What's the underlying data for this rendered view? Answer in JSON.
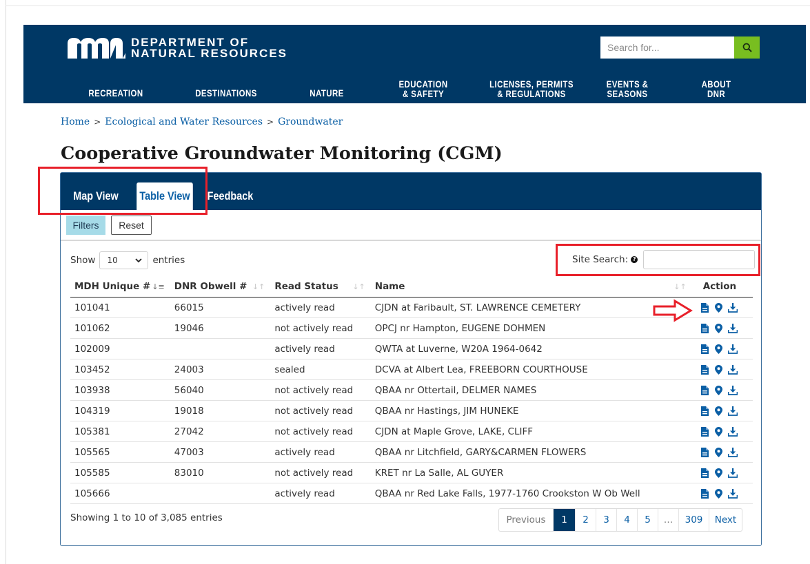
{
  "header": {
    "logo_text_line1": "DEPARTMENT OF",
    "logo_text_line2": "NATURAL RESOURCES",
    "search_placeholder": "Search for...",
    "nav": [
      {
        "label": "RECREATION"
      },
      {
        "label": "DESTINATIONS"
      },
      {
        "label": "NATURE"
      },
      {
        "label": "EDUCATION\n& SAFETY"
      },
      {
        "label": "LICENSES, PERMITS\n& REGULATIONS"
      },
      {
        "label": "EVENTS &\nSEASONS"
      },
      {
        "label": "ABOUT\nDNR"
      }
    ],
    "colors": {
      "bar": "#003865",
      "search_button": "#78be20"
    }
  },
  "breadcrumb": {
    "items": [
      "Home",
      "Ecological and Water Resources",
      "Groundwater"
    ],
    "separator": ">"
  },
  "page_title": "Cooperative Groundwater Monitoring (CGM)",
  "tabs": [
    {
      "label": "Map View",
      "active": false
    },
    {
      "label": "Table View",
      "active": true
    },
    {
      "label": "Feedback",
      "active": false
    }
  ],
  "filters": {
    "filters_label": "Filters",
    "reset_label": "Reset"
  },
  "length": {
    "show_label": "Show",
    "value": "10",
    "entries_label": "entries"
  },
  "site_search": {
    "label": "Site Search:",
    "value": "",
    "help_icon": "question-circle-icon"
  },
  "table": {
    "columns": [
      "MDH Unique #",
      "DNR Obwell #",
      "Read Status",
      "Name",
      "Action"
    ],
    "action_icons": [
      "file-icon",
      "map-marker-icon",
      "download-icon"
    ],
    "rows": [
      {
        "mdh": "101041",
        "dnr": "66015",
        "status": "actively read",
        "name": "CJDN at Faribault, ST. LAWRENCE CEMETERY"
      },
      {
        "mdh": "101062",
        "dnr": "19046",
        "status": "not actively read",
        "name": "OPCJ nr Hampton, EUGENE DOHMEN"
      },
      {
        "mdh": "102009",
        "dnr": "",
        "status": "actively read",
        "name": "QWTA at Luverne, W20A 1964-0642"
      },
      {
        "mdh": "103452",
        "dnr": "24003",
        "status": "sealed",
        "name": "DCVA at Albert Lea, FREEBORN COURTHOUSE"
      },
      {
        "mdh": "103938",
        "dnr": "56040",
        "status": "not actively read",
        "name": "QBAA nr Ottertail, DELMER NAMES"
      },
      {
        "mdh": "104319",
        "dnr": "19018",
        "status": "not actively read",
        "name": "QBAA nr Hastings, JIM HUNEKE"
      },
      {
        "mdh": "105381",
        "dnr": "27042",
        "status": "not actively read",
        "name": "CJDN at Maple Grove, LAKE, CLIFF"
      },
      {
        "mdh": "105565",
        "dnr": "47003",
        "status": "actively read",
        "name": "QBAA nr Litchfield, GARY&CARMEN FLOWERS"
      },
      {
        "mdh": "105585",
        "dnr": "83010",
        "status": "not actively read",
        "name": "KRET nr La Salle, AL GUYER"
      },
      {
        "mdh": "105666",
        "dnr": "",
        "status": "actively read",
        "name": "QBAA nr Red Lake Falls, 1977-1760 Crookston W Ob Well"
      }
    ]
  },
  "footer": {
    "info": "Showing 1 to 10 of 3,085 entries",
    "pagination": [
      "Previous",
      "1",
      "2",
      "3",
      "4",
      "5",
      "…",
      "309",
      "Next"
    ],
    "current_page": "1"
  },
  "annotation_color": "#e8202a"
}
